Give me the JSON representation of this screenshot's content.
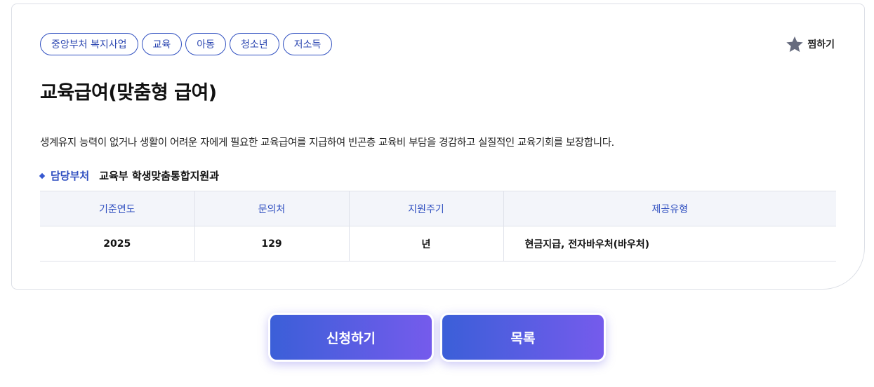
{
  "tags": [
    "중앙부처 복지사업",
    "교육",
    "아동",
    "청소년",
    "저소득"
  ],
  "favorite": {
    "label": "찜하기",
    "icon": "star-icon"
  },
  "title": "교육급여(맞춤형 급여)",
  "description": "생계유지 능력이 없거나 생활이 어려운 자에게 필요한 교육급여를 지급하여 빈곤층 교육비 부담을 경감하고 실질적인 교육기회를 보장합니다.",
  "department": {
    "label": "담당부처",
    "value": "교육부 학생맞춤통합지원과"
  },
  "table": {
    "headers": [
      "기준연도",
      "문의처",
      "지원주기",
      "제공유형"
    ],
    "row": [
      "2025",
      "129",
      "년",
      "현금지급, 전자바우처(바우처)"
    ]
  },
  "buttons": {
    "apply": "신청하기",
    "list": "목록"
  },
  "colors": {
    "accent": "#2f4fc0",
    "gradient_start": "#3b5fd8",
    "gradient_end": "#755bec"
  }
}
